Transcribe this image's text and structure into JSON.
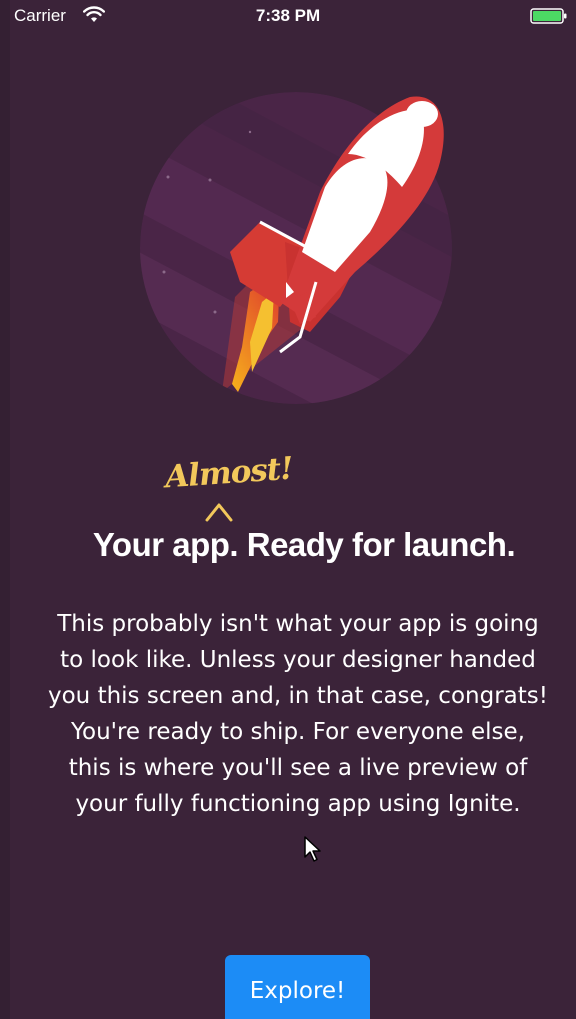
{
  "status_bar": {
    "carrier": "Carrier",
    "time": "7:38 PM",
    "icons": [
      "wifi-icon",
      "battery-icon"
    ]
  },
  "hero": {
    "icon": "rocket-illustration",
    "colors": {
      "circle": "#4e2b4e",
      "rocket_red": "#d43a3a",
      "rocket_white": "#ffffff",
      "flame": "#f5a623"
    }
  },
  "annotation": {
    "text": "Almost!",
    "color": "#f2c85b"
  },
  "title": "Your app. Ready for launch.",
  "description": "This probably isn't what your app is going to look like. Unless your designer handed you this screen and, in that case, congrats! You're ready to ship. For everyone else, this is where you'll see a live preview of your fully functioning app using Ignite.",
  "button": {
    "label": "Explore!",
    "color": "#1c8cf6"
  },
  "colors": {
    "background": "#3b2339"
  }
}
